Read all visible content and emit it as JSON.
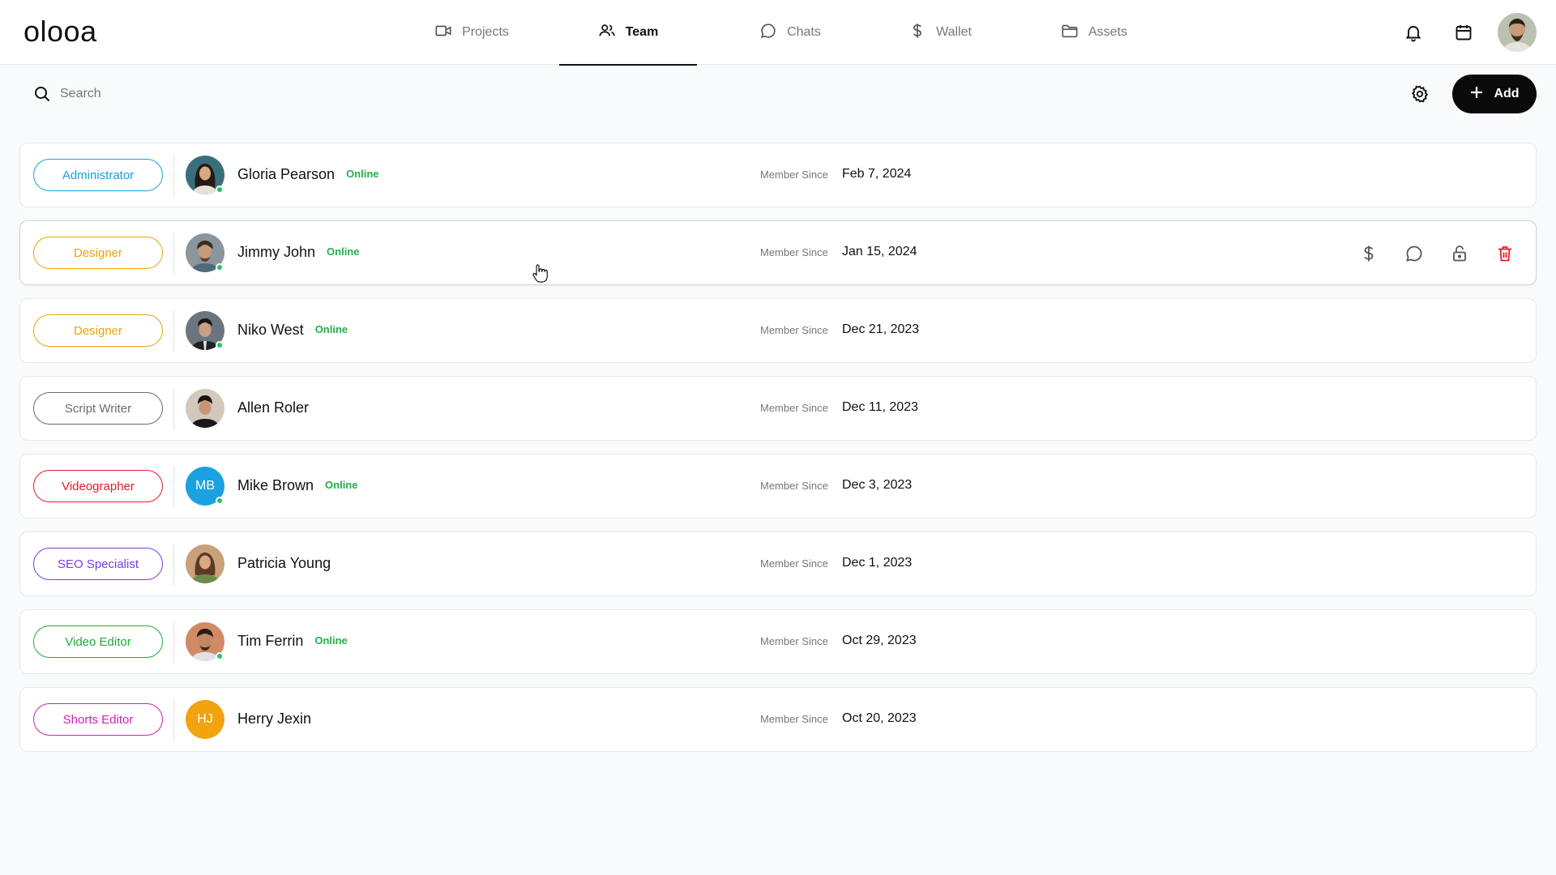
{
  "app": {
    "logo": "olooa"
  },
  "nav": [
    {
      "label": "Projects",
      "icon": "video-camera-icon",
      "active": false
    },
    {
      "label": "Team",
      "icon": "users-icon",
      "active": true
    },
    {
      "label": "Chats",
      "icon": "chat-bubble-icon",
      "active": false
    },
    {
      "label": "Wallet",
      "icon": "dollar-icon",
      "active": false
    },
    {
      "label": "Assets",
      "icon": "folder-icon",
      "active": false
    }
  ],
  "header_icons": [
    "bell-icon",
    "calendar-icon",
    "user-avatar"
  ],
  "toolbar": {
    "search_placeholder": "Search",
    "add_label": "Add"
  },
  "members": [
    {
      "role": "Administrator",
      "role_color": "#1aa0d8",
      "name": "Gloria Pearson",
      "online": "Online",
      "is_online": true,
      "since_label": "Member Since",
      "since": "Feb 7, 2024",
      "avatar": "photo",
      "avatar_bg": "#3a6f7a"
    },
    {
      "role": "Designer",
      "role_color": "#e8a40c",
      "name": "Jimmy John",
      "online": "Online",
      "is_online": true,
      "since_label": "Member Since",
      "since": "Jan 15, 2024",
      "avatar": "photo",
      "avatar_bg": "#7a8a92"
    },
    {
      "role": "Designer",
      "role_color": "#e8a40c",
      "name": "Niko West",
      "online": "Online",
      "is_online": true,
      "since_label": "Member Since",
      "since": "Dec 21, 2023",
      "avatar": "photo",
      "avatar_bg": "#5d6770"
    },
    {
      "role": "Script Writer",
      "role_color": "#6b6b6b",
      "name": "Allen Roler",
      "online": "",
      "is_online": false,
      "since_label": "Member Since",
      "since": "Dec 11, 2023",
      "avatar": "photo",
      "avatar_bg": "#c9bfb3"
    },
    {
      "role": "Videographer",
      "role_color": "#e11d2a",
      "name": "Mike Brown",
      "online": "Online",
      "is_online": true,
      "since_label": "Member Since",
      "since": "Dec 3, 2023",
      "avatar": "initials",
      "initials": "MB",
      "avatar_bg": "#1ba1e2"
    },
    {
      "role": "SEO Specialist",
      "role_color": "#7c3aed",
      "name": "Patricia Young",
      "online": "",
      "is_online": false,
      "since_label": "Member Since",
      "since": "Dec 1, 2023",
      "avatar": "photo",
      "avatar_bg": "#b98a62"
    },
    {
      "role": "Video Editor",
      "role_color": "#22a83a",
      "name": "Tim Ferrin",
      "online": "Online",
      "is_online": true,
      "since_label": "Member Since",
      "since": "Oct 29, 2023",
      "avatar": "photo",
      "avatar_bg": "#c0805e"
    },
    {
      "role": "Shorts Editor",
      "role_color": "#d41fb7",
      "name": "Herry Jexin",
      "online": "",
      "is_online": false,
      "since_label": "Member Since",
      "since": "Oct 20, 2023",
      "avatar": "initials",
      "initials": "HJ",
      "avatar_bg": "#f2a30f"
    }
  ],
  "hovered_row_actions": [
    "dollar-icon",
    "chat-bubble-icon",
    "lock-icon",
    "trash-icon"
  ],
  "colors": {
    "online": "#22b14c",
    "delete": "#e11d2a",
    "accent": "#0a0a0a"
  }
}
